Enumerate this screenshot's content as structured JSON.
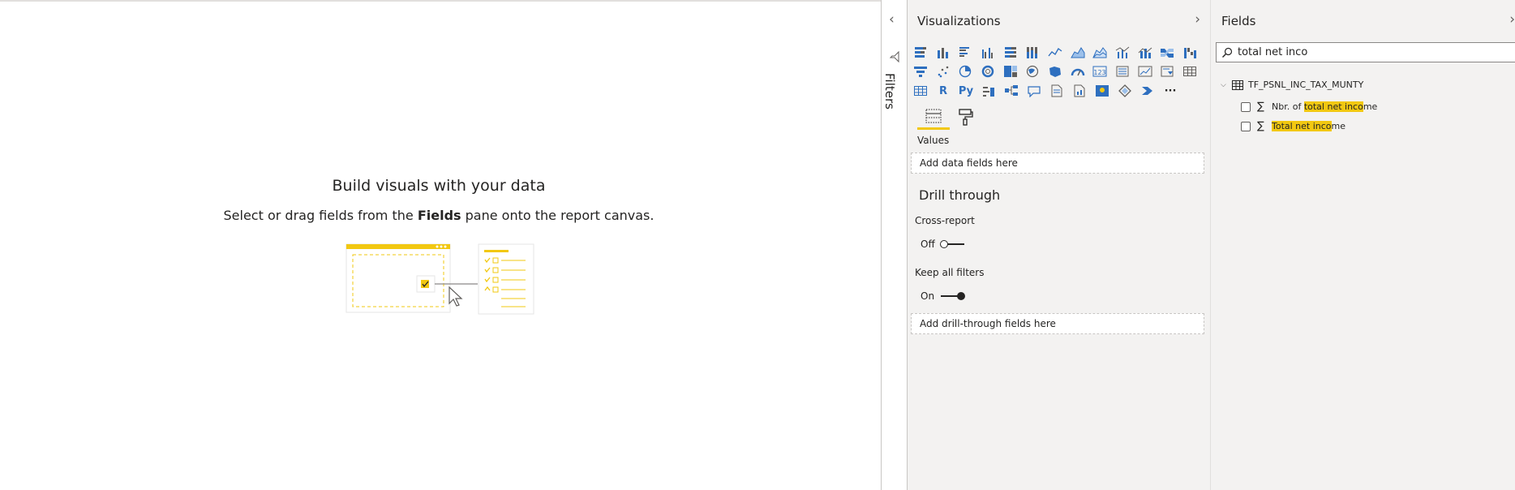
{
  "canvas": {
    "title": "Build visuals with your data",
    "subtitle_pre": "Select or drag fields from the ",
    "subtitle_bold": "Fields",
    "subtitle_post": " pane onto the report canvas."
  },
  "filters_pane": {
    "label": "Filters",
    "expand_icon": "chevron-left-icon"
  },
  "visualizations": {
    "title": "Visualizations",
    "rows": [
      [
        "stacked-bar",
        "stacked-column",
        "clustered-bar",
        "clustered-column",
        "100-stacked-bar",
        "100-stacked-column",
        "line",
        "area",
        "stacked-area",
        "line-clustered-column",
        "line-stacked-column",
        "ribbon",
        "waterfall"
      ],
      [
        "funnel",
        "scatter",
        "pie",
        "donut",
        "treemap",
        "map",
        "filled-map",
        "gauge",
        "card",
        "multi-row-card",
        "kpi",
        "slicer",
        "table"
      ],
      [
        "matrix",
        "r-visual",
        "python-visual",
        "key-influencers",
        "decomposition-tree",
        "qa",
        "smart-narrative",
        "paginated-report",
        "azure-map",
        "power-apps",
        "power-automate",
        "more"
      ]
    ],
    "r_label": "R",
    "py_label": "Py",
    "more_label": "···",
    "tabs": [
      "fields-build-tab",
      "format-tab"
    ],
    "values_label": "Values",
    "values_well": "Add data fields here",
    "drill_through": "Drill through",
    "cross_report_label": "Cross-report",
    "cross_report_state": "Off",
    "keep_filters_label": "Keep all filters",
    "keep_filters_state": "On",
    "drill_well": "Add drill-through fields here"
  },
  "fields": {
    "title": "Fields",
    "search_value": "total net inco",
    "table_name": "TF_PSNL_INC_TAX_MUNTY",
    "items": [
      {
        "pre": "Nbr. of ",
        "hl": "total net inco",
        "post": "me"
      },
      {
        "pre": "",
        "hl": "Total net inco",
        "post": "me"
      }
    ]
  },
  "colors": {
    "accent": "#f2c811",
    "icon_blue": "#2e6fbf",
    "pane_bg": "#f3f2f1"
  }
}
